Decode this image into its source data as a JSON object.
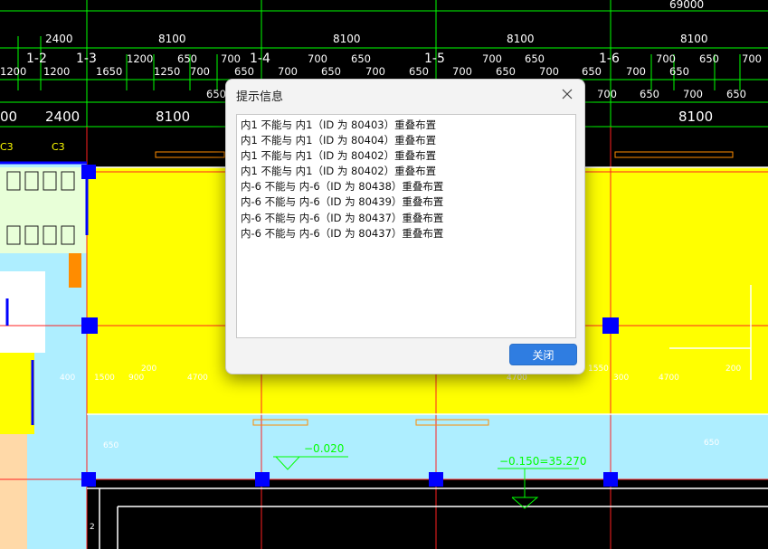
{
  "drawing": {
    "colors": {
      "yellow": "#ffff00",
      "cyan": "#aeeeff",
      "green": "#00ff00",
      "red": "#ff2020",
      "blue": "#0000ff",
      "white": "#ffffff",
      "peach": "#ffd9a8"
    },
    "top_dim": "69000",
    "row1_dims": [
      "2400",
      "8100",
      "8100",
      "8100",
      "8100"
    ],
    "row2_dims": [
      "1200",
      "1200",
      "1650",
      "1200",
      "1250",
      "700",
      "650",
      "700",
      "650",
      "700",
      "650",
      "700",
      "650",
      "700",
      "650",
      "700",
      "650",
      "700",
      "650",
      "700",
      "650",
      "700",
      "650",
      "700",
      "650",
      "700"
    ],
    "axis_labels": [
      "1-2",
      "1-3",
      "1-4",
      "1-5",
      "1-6"
    ],
    "row3_dims": [
      "650",
      "700",
      "650",
      "700",
      "650"
    ],
    "row4_dims": [
      "2400",
      "8100",
      "8100"
    ],
    "col_tags": [
      "C3",
      "C3"
    ],
    "left_frag": "00",
    "elevation_1": "−0.020",
    "elevation_2": "−0.150=35.270",
    "small_dims": [
      "400",
      "1500",
      "900",
      "200",
      "4700",
      "4700",
      "1550",
      "300",
      "4700",
      "200",
      "650",
      "650",
      "2"
    ]
  },
  "dialog": {
    "title": "提示信息",
    "messages": [
      "内1 不能与 内1（ID 为 80403）重叠布置",
      "内1 不能与 内1（ID 为 80404）重叠布置",
      "内1 不能与 内1（ID 为 80402）重叠布置",
      "内1 不能与 内1（ID 为 80402）重叠布置",
      "内-6 不能与 内-6（ID 为 80438）重叠布置",
      "内-6 不能与 内-6（ID 为 80439）重叠布置",
      "内-6 不能与 内-6（ID 为 80437）重叠布置",
      "内-6 不能与 内-6（ID 为 80437）重叠布置"
    ],
    "ok_label": "关闭",
    "close_icon": "close-icon"
  }
}
